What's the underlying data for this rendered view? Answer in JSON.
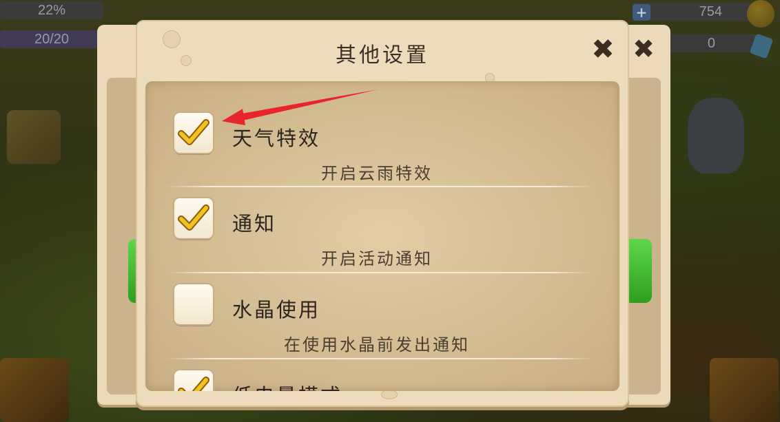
{
  "hud": {
    "xp_percent": "22%",
    "energy": "20/20",
    "coins": "754",
    "gems": "0",
    "plus_label": "+"
  },
  "dialog": {
    "title": "其他设置",
    "close_icon": "✖",
    "back_close_icon": "✖"
  },
  "settings": [
    {
      "name": "天气特效",
      "description": "开启云雨特效",
      "checked": true
    },
    {
      "name": "通知",
      "description": "开启活动通知",
      "checked": true
    },
    {
      "name": "水晶使用",
      "description": "在使用水晶前发出通知",
      "checked": false
    },
    {
      "name": "低电量模式",
      "description": "",
      "checked": true
    }
  ],
  "colors": {
    "panel": "#ecdcbc",
    "content": "#d6bf96",
    "check_gold": "#e8b21c",
    "annotation_red": "#e8242c",
    "green_button": "#3cbc2c"
  }
}
